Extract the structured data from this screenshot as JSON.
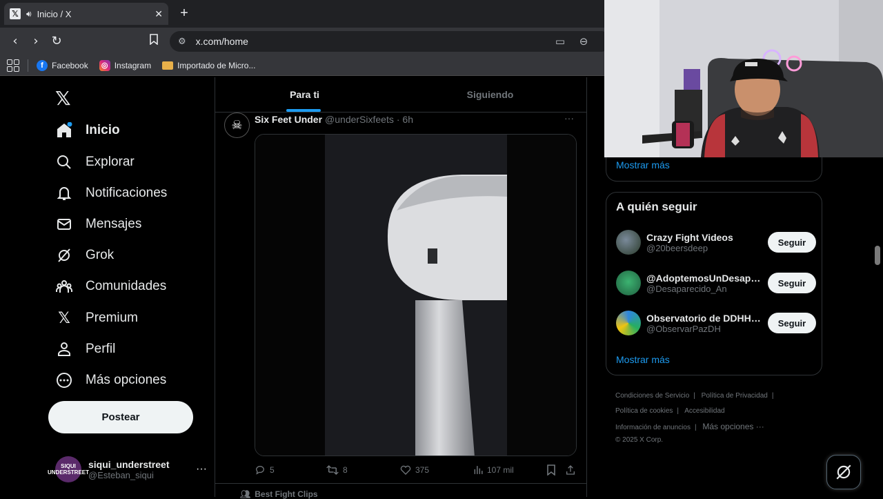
{
  "browser": {
    "tab_title": "Inicio / X",
    "url": "x.com/home",
    "bookmarks": [
      {
        "label": "Facebook",
        "color": "#1877f2"
      },
      {
        "label": "Instagram",
        "color": "#e1306c"
      },
      {
        "label": "Importado de Micro...",
        "color": "#e8b04a"
      }
    ]
  },
  "sidebar": {
    "items": [
      {
        "label": "Inicio"
      },
      {
        "label": "Explorar"
      },
      {
        "label": "Notificaciones"
      },
      {
        "label": "Mensajes"
      },
      {
        "label": "Grok"
      },
      {
        "label": "Comunidades"
      },
      {
        "label": "Premium"
      },
      {
        "label": "Perfil"
      },
      {
        "label": "Más opciones"
      }
    ],
    "post_label": "Postear",
    "account": {
      "name": "siqui_understreet",
      "handle": "@Esteban_siqui",
      "avatar_text": "SIQUI UNDERSTREET"
    }
  },
  "timeline": {
    "tabs": [
      {
        "label": "Para ti"
      },
      {
        "label": "Siguiendo"
      }
    ],
    "tweet": {
      "name": "Six Feet Under",
      "handle": "@underSixfeets",
      "time": "· 6h",
      "replies": "5",
      "retweets": "8",
      "likes": "375",
      "views": "107 mil"
    },
    "next_label": "Best Fight Clips"
  },
  "right": {
    "prev_more": "Mostrar más",
    "follow_title": "A quién seguir",
    "follow": [
      {
        "name": "Crazy Fight Videos",
        "handle": "@20beersdeep",
        "button": "Seguir"
      },
      {
        "name": "@AdoptemosUnDesaparecido",
        "handle": "@Desaparecido_An",
        "button": "Seguir"
      },
      {
        "name": "Observatorio de DDHH de Paz",
        "handle": "@ObservarPazDH",
        "button": "Seguir"
      }
    ],
    "follow_more": "Mostrar más",
    "footer": {
      "terms": "Condiciones de Servicio",
      "privacy": "Política de Privacidad",
      "cookies": "Política de cookies",
      "accessibility": "Accesibilidad",
      "ads": "Información de anuncios",
      "more": "Más opciones ···",
      "copyright": "© 2025 X Corp."
    }
  },
  "colors": {
    "accent": "#1d9bf0",
    "background": "#000000",
    "border": "#2f3336"
  }
}
